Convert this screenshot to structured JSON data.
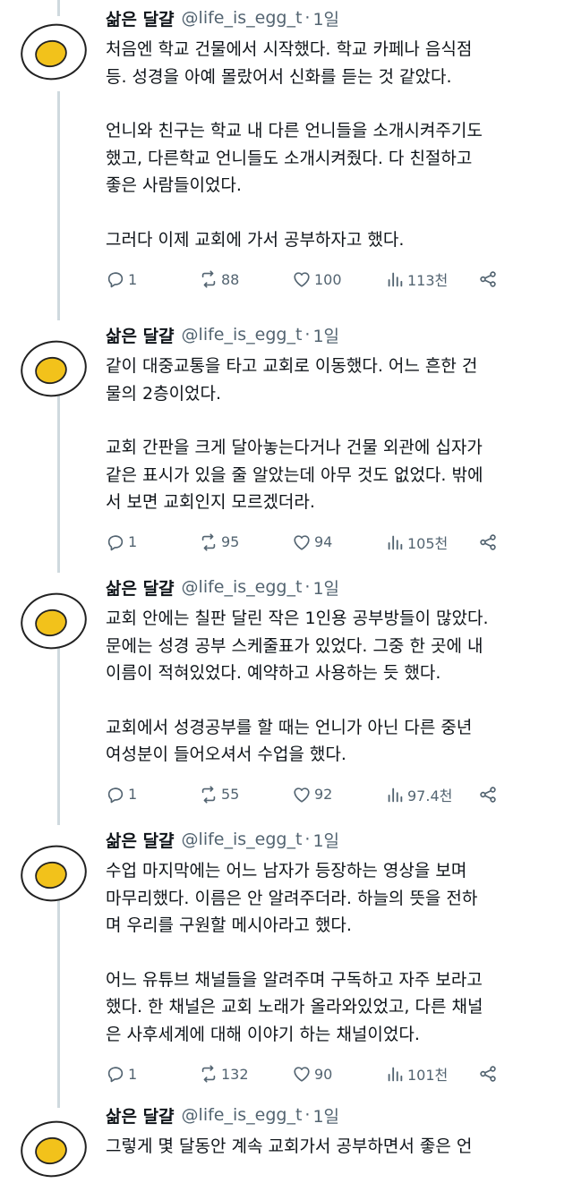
{
  "tweets": [
    {
      "author": "삶은 달걀",
      "handle": "@life_is_egg_t",
      "sep": "·",
      "time": "1일",
      "paragraphs": [
        "처음엔 학교 건물에서 시작했다. 학교 카페나 음식점\n등. 성경을 아예 몰랐어서 신화를 듣는 것 같았다.",
        "언니와 친구는 학교 내 다른 언니들을 소개시켜주기도\n했고, 다른학교 언니들도 소개시켜줬다. 다 친절하고\n좋은 사람들이었다.",
        "그러다 이제 교회에 가서 공부하자고 했다."
      ],
      "replies": "1",
      "retweets": "88",
      "likes": "100",
      "views": "113천"
    },
    {
      "author": "삶은 달걀",
      "handle": "@life_is_egg_t",
      "sep": "·",
      "time": "1일",
      "paragraphs": [
        "같이 대중교통을 타고 교회로 이동했다. 어느 흔한 건\n물의 2층이었다.",
        "교회 간판을 크게 달아놓는다거나 건물 외관에 십자가\n같은 표시가 있을 줄 알았는데 아무 것도 없었다. 밖에\n서 보면 교회인지 모르겠더라."
      ],
      "replies": "1",
      "retweets": "95",
      "likes": "94",
      "views": "105천"
    },
    {
      "author": "삶은 달걀",
      "handle": "@life_is_egg_t",
      "sep": "·",
      "time": "1일",
      "paragraphs": [
        "교회 안에는 칠판 달린 작은 1인용 공부방들이 많았다.\n문에는 성경 공부 스케줄표가 있었다. 그중 한 곳에 내\n이름이 적혀있었다. 예약하고 사용하는 듯 했다.",
        "교회에서 성경공부를 할 때는 언니가 아닌 다른 중년\n여성분이 들어오셔서 수업을 했다."
      ],
      "replies": "1",
      "retweets": "55",
      "likes": "92",
      "views": "97.4천"
    },
    {
      "author": "삶은 달걀",
      "handle": "@life_is_egg_t",
      "sep": "·",
      "time": "1일",
      "paragraphs": [
        "수업 마지막에는 어느 남자가 등장하는 영상을 보며\n마무리했다. 이름은 안 알려주더라. 하늘의 뜻을 전하\n며 우리를 구원할 메시아라고 했다.",
        "어느 유튜브 채널들을 알려주며 구독하고 자주 보라고\n했다. 한 채널은 교회 노래가 올라와있었고, 다른 채널\n은 사후세계에 대해 이야기 하는 채널이었다."
      ],
      "replies": "1",
      "retweets": "132",
      "likes": "90",
      "views": "101천"
    },
    {
      "author": "삶은 달걀",
      "handle": "@life_is_egg_t",
      "sep": "·",
      "time": "1일",
      "paragraphs": [
        "그렇게 몇 달동안 계속 교회가서 공부하면서 좋은 언"
      ]
    }
  ],
  "icons": {
    "reply": "reply-icon",
    "retweet": "retweet-icon",
    "like": "heart-icon",
    "views": "views-icon",
    "share": "share-icon",
    "more": "more-icon",
    "avatar": "boiled-egg-avatar"
  },
  "colors": {
    "text": "#0f1419",
    "secondary": "#536471",
    "thread_line": "#cfd9de",
    "egg_yolk": "#f2c21b",
    "egg_white": "#ffffff"
  }
}
